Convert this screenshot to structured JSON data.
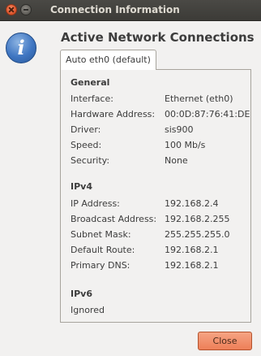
{
  "window": {
    "title": "Connection Information"
  },
  "icons": {
    "info": "i"
  },
  "heading": "Active Network Connections",
  "tab": {
    "label": "Auto eth0 (default)"
  },
  "general": {
    "title": "General",
    "interface_label": "Interface:",
    "interface_value": "Ethernet (eth0)",
    "hw_label": "Hardware Address:",
    "hw_value": "00:0D:87:76:41:DE",
    "driver_label": "Driver:",
    "driver_value": "sis900",
    "speed_label": "Speed:",
    "speed_value": "100 Mb/s",
    "security_label": "Security:",
    "security_value": "None"
  },
  "ipv4": {
    "title": "IPv4",
    "ip_label": "IP Address:",
    "ip_value": "192.168.2.4",
    "broadcast_label": "Broadcast Address:",
    "broadcast_value": "192.168.2.255",
    "subnet_label": "Subnet Mask:",
    "subnet_value": "255.255.255.0",
    "route_label": "Default Route:",
    "route_value": "192.168.2.1",
    "dns_label": "Primary DNS:",
    "dns_value": "192.168.2.1"
  },
  "ipv6": {
    "title": "IPv6",
    "status": "Ignored"
  },
  "buttons": {
    "close": "Close"
  },
  "colors": {
    "titlebar": "#3c3b37",
    "window_bg": "#f2f1f0",
    "close_button": "#ee7f58",
    "info_icon": "#3f76c2"
  }
}
